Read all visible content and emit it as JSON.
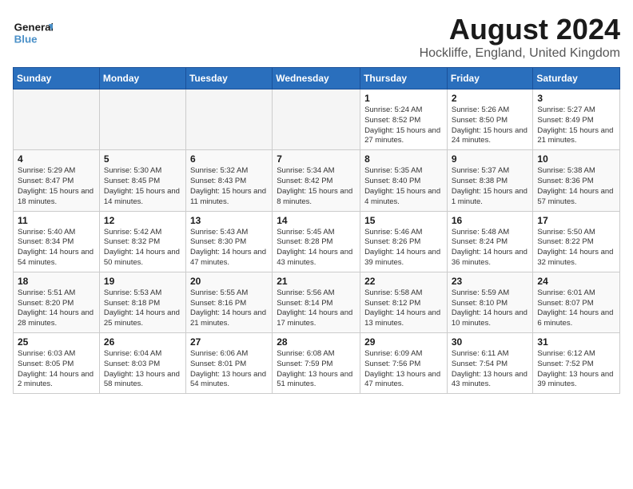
{
  "header": {
    "logo_line1": "General",
    "logo_line2": "Blue",
    "month_year": "August 2024",
    "location": "Hockliffe, England, United Kingdom"
  },
  "days_of_week": [
    "Sunday",
    "Monday",
    "Tuesday",
    "Wednesday",
    "Thursday",
    "Friday",
    "Saturday"
  ],
  "weeks": [
    [
      {
        "day": "",
        "empty": true
      },
      {
        "day": "",
        "empty": true
      },
      {
        "day": "",
        "empty": true
      },
      {
        "day": "",
        "empty": true
      },
      {
        "day": "1",
        "rise": "5:24 AM",
        "set": "8:52 PM",
        "daylight": "15 hours and 27 minutes."
      },
      {
        "day": "2",
        "rise": "5:26 AM",
        "set": "8:50 PM",
        "daylight": "15 hours and 24 minutes."
      },
      {
        "day": "3",
        "rise": "5:27 AM",
        "set": "8:49 PM",
        "daylight": "15 hours and 21 minutes."
      }
    ],
    [
      {
        "day": "4",
        "rise": "5:29 AM",
        "set": "8:47 PM",
        "daylight": "15 hours and 18 minutes."
      },
      {
        "day": "5",
        "rise": "5:30 AM",
        "set": "8:45 PM",
        "daylight": "15 hours and 14 minutes."
      },
      {
        "day": "6",
        "rise": "5:32 AM",
        "set": "8:43 PM",
        "daylight": "15 hours and 11 minutes."
      },
      {
        "day": "7",
        "rise": "5:34 AM",
        "set": "8:42 PM",
        "daylight": "15 hours and 8 minutes."
      },
      {
        "day": "8",
        "rise": "5:35 AM",
        "set": "8:40 PM",
        "daylight": "15 hours and 4 minutes."
      },
      {
        "day": "9",
        "rise": "5:37 AM",
        "set": "8:38 PM",
        "daylight": "15 hours and 1 minute."
      },
      {
        "day": "10",
        "rise": "5:38 AM",
        "set": "8:36 PM",
        "daylight": "14 hours and 57 minutes."
      }
    ],
    [
      {
        "day": "11",
        "rise": "5:40 AM",
        "set": "8:34 PM",
        "daylight": "14 hours and 54 minutes."
      },
      {
        "day": "12",
        "rise": "5:42 AM",
        "set": "8:32 PM",
        "daylight": "14 hours and 50 minutes."
      },
      {
        "day": "13",
        "rise": "5:43 AM",
        "set": "8:30 PM",
        "daylight": "14 hours and 47 minutes."
      },
      {
        "day": "14",
        "rise": "5:45 AM",
        "set": "8:28 PM",
        "daylight": "14 hours and 43 minutes."
      },
      {
        "day": "15",
        "rise": "5:46 AM",
        "set": "8:26 PM",
        "daylight": "14 hours and 39 minutes."
      },
      {
        "day": "16",
        "rise": "5:48 AM",
        "set": "8:24 PM",
        "daylight": "14 hours and 36 minutes."
      },
      {
        "day": "17",
        "rise": "5:50 AM",
        "set": "8:22 PM",
        "daylight": "14 hours and 32 minutes."
      }
    ],
    [
      {
        "day": "18",
        "rise": "5:51 AM",
        "set": "8:20 PM",
        "daylight": "14 hours and 28 minutes."
      },
      {
        "day": "19",
        "rise": "5:53 AM",
        "set": "8:18 PM",
        "daylight": "14 hours and 25 minutes."
      },
      {
        "day": "20",
        "rise": "5:55 AM",
        "set": "8:16 PM",
        "daylight": "14 hours and 21 minutes."
      },
      {
        "day": "21",
        "rise": "5:56 AM",
        "set": "8:14 PM",
        "daylight": "14 hours and 17 minutes."
      },
      {
        "day": "22",
        "rise": "5:58 AM",
        "set": "8:12 PM",
        "daylight": "14 hours and 13 minutes."
      },
      {
        "day": "23",
        "rise": "5:59 AM",
        "set": "8:10 PM",
        "daylight": "14 hours and 10 minutes."
      },
      {
        "day": "24",
        "rise": "6:01 AM",
        "set": "8:07 PM",
        "daylight": "14 hours and 6 minutes."
      }
    ],
    [
      {
        "day": "25",
        "rise": "6:03 AM",
        "set": "8:05 PM",
        "daylight": "14 hours and 2 minutes."
      },
      {
        "day": "26",
        "rise": "6:04 AM",
        "set": "8:03 PM",
        "daylight": "13 hours and 58 minutes."
      },
      {
        "day": "27",
        "rise": "6:06 AM",
        "set": "8:01 PM",
        "daylight": "13 hours and 54 minutes."
      },
      {
        "day": "28",
        "rise": "6:08 AM",
        "set": "7:59 PM",
        "daylight": "13 hours and 51 minutes."
      },
      {
        "day": "29",
        "rise": "6:09 AM",
        "set": "7:56 PM",
        "daylight": "13 hours and 47 minutes."
      },
      {
        "day": "30",
        "rise": "6:11 AM",
        "set": "7:54 PM",
        "daylight": "13 hours and 43 minutes."
      },
      {
        "day": "31",
        "rise": "6:12 AM",
        "set": "7:52 PM",
        "daylight": "13 hours and 39 minutes."
      }
    ]
  ]
}
